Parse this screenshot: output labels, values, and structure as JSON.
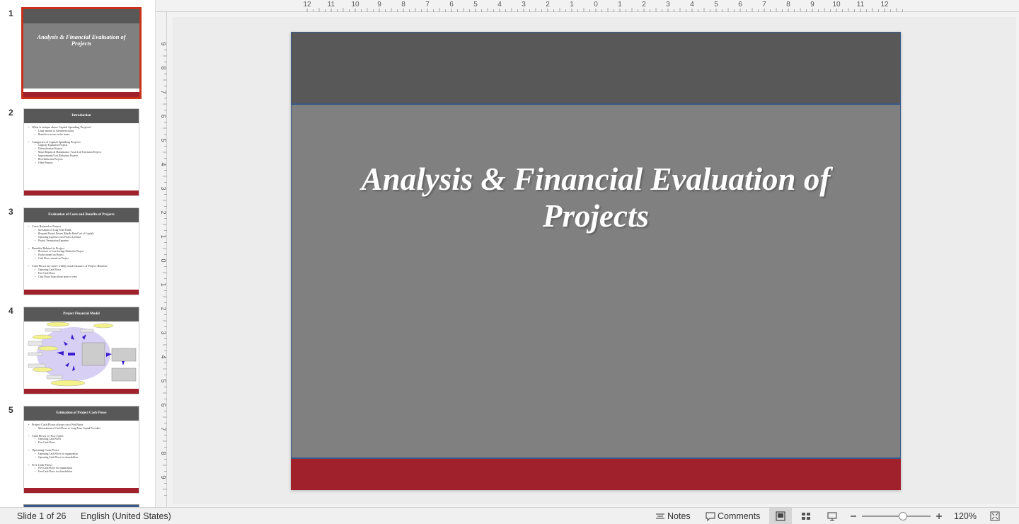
{
  "thumbnails": [
    {
      "num": "1",
      "title": "Analysis & Financial Evaluation of Projects"
    },
    {
      "num": "2",
      "title": "Introduction",
      "lines": [
        [
          "1",
          "What is unique about Capital Spending Projects?"
        ],
        [
          "2",
          "Large amount of investment outlay"
        ],
        [
          "2",
          "Benefits to accrue in the future"
        ],
        [
          "g",
          ""
        ],
        [
          "1",
          "Categories of Capital Spending Projects"
        ],
        [
          "2",
          "Capacity Expansion Projects"
        ],
        [
          "2",
          "Diversification Projects"
        ],
        [
          "2",
          "Major Repairs & Maintenance / Asset Life Extension Projects"
        ],
        [
          "2",
          "Improvements/Cost Reduction Projects"
        ],
        [
          "2",
          "Risk Reduction Projects"
        ],
        [
          "2",
          "Other Projects"
        ]
      ]
    },
    {
      "num": "3",
      "title": "Evaluation of Costs and Benefits of Projects",
      "lines": [
        [
          "1",
          "Costs Related to Project"
        ],
        [
          "2",
          "Investment of Long-Term Funds"
        ],
        [
          "2",
          "Required Project Return (Hurdle Rate/Cost of Capital)"
        ],
        [
          "2",
          "Operating Expenses over Project Lifetime"
        ],
        [
          "2",
          "Project Termination Expenses"
        ],
        [
          "g",
          ""
        ],
        [
          "1",
          "Benefits Related to Project"
        ],
        [
          "2",
          "Revenues or Cost Savings Related to Project"
        ],
        [
          "2",
          "Profits earned on Project"
        ],
        [
          "2",
          "Cash Flows earned on Project"
        ],
        [
          "g",
          ""
        ],
        [
          "1",
          "Cash Flows are more widely used measure of Project Benefits"
        ],
        [
          "2",
          "Operating Cash Flows"
        ],
        [
          "2",
          "Free Cash Flows"
        ],
        [
          "2",
          "Cash Flows from whose point of view"
        ]
      ]
    },
    {
      "num": "4",
      "title": "Project Financial Model"
    },
    {
      "num": "5",
      "title": "Estimation of Project Cash Flows",
      "lines": [
        [
          "1",
          "Project Cash Flows always on a Net Basis"
        ],
        [
          "2",
          "Measurement of Cash Flows to Long-Term Capital Providers"
        ],
        [
          "g",
          ""
        ],
        [
          "1",
          "Cash Flows of Two Types"
        ],
        [
          "2",
          "Operating Cash Flows"
        ],
        [
          "2",
          "Free Cash Flows"
        ],
        [
          "g",
          ""
        ],
        [
          "1",
          "Operating Cash Flows"
        ],
        [
          "2",
          "Operating Cash Flows for organization"
        ],
        [
          "2",
          "Operating Cash Flows for shareholders"
        ],
        [
          "g",
          ""
        ],
        [
          "1",
          "Free Cash Flows"
        ],
        [
          "2",
          "Free Cash Flows for organization"
        ],
        [
          "2",
          "Free Cash Flows for shareholders"
        ]
      ]
    }
  ],
  "slide": {
    "title_line1": "Analysis & Financial Evaluation of",
    "title_line2": "Projects",
    "colors": {
      "header": "#585858",
      "body": "#808080",
      "footer": "#a0202c",
      "border": "#3a5a8a"
    }
  },
  "ruler": {
    "h_labels": [
      "12",
      "11",
      "10",
      "9",
      "8",
      "7",
      "6",
      "5",
      "4",
      "3",
      "2",
      "1",
      "0",
      "1",
      "2",
      "3",
      "4",
      "5",
      "6",
      "7",
      "8",
      "9",
      "10",
      "11",
      "12"
    ],
    "v_labels": [
      "9",
      "8",
      "7",
      "6",
      "5",
      "4",
      "3",
      "2",
      "1",
      "0",
      "1",
      "2",
      "3",
      "4",
      "5",
      "6",
      "7",
      "8",
      "9"
    ]
  },
  "status": {
    "slide_info": "Slide 1 of 26",
    "language": "English (United States)",
    "notes": "Notes",
    "comments": "Comments",
    "zoom": "120%",
    "zoom_level": 0.6,
    "icons": [
      "notes-icon",
      "comments-icon",
      "normal-view-icon",
      "slide-sorter-icon",
      "presenter-view-icon",
      "zoom-out-icon",
      "zoom-in-icon",
      "fit-to-window-icon"
    ]
  }
}
